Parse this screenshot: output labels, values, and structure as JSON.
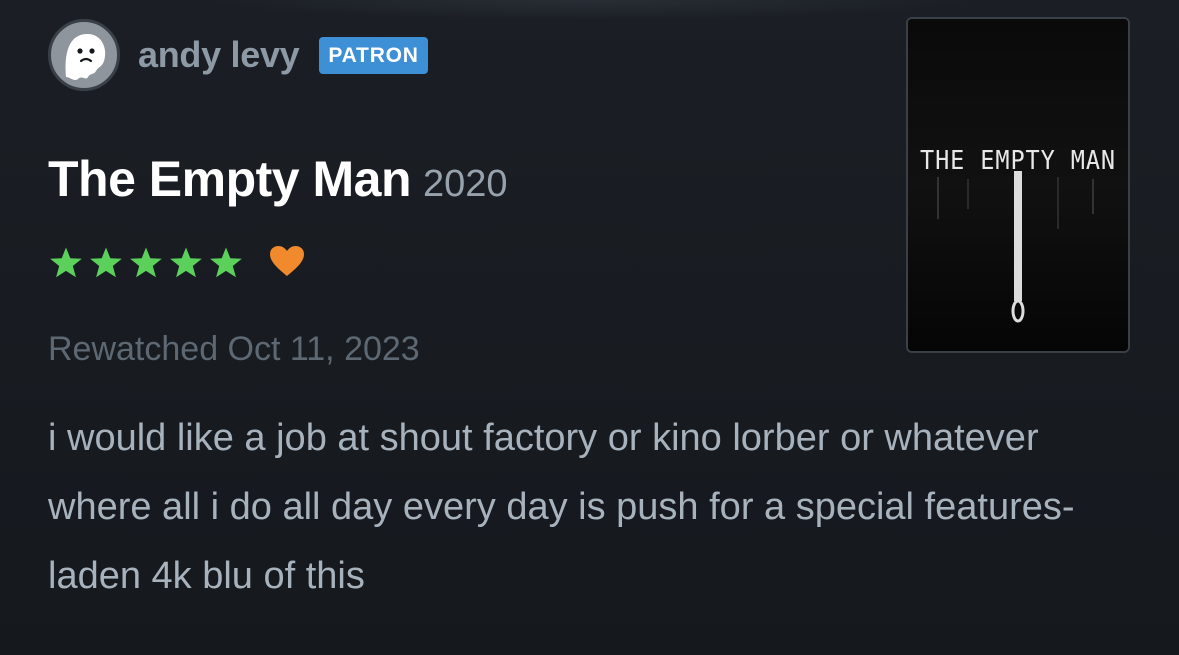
{
  "user": {
    "name": "andy levy",
    "badge": "PATRON"
  },
  "film": {
    "title": "The Empty Man",
    "year": "2020",
    "poster_text": "THE EMPTY MAN"
  },
  "rating": {
    "stars": 5,
    "max_stars": 5,
    "liked": true,
    "star_color": "#40bcf4",
    "star_fill": "#5bd15b",
    "heart_color": "#f1892d"
  },
  "watched": {
    "label": "Rewatched Oct 11, 2023"
  },
  "review": {
    "text": "i would like a job at shout factory or kino lorber or whatever where all i do all day every day is push for a special features-laden 4k blu of this"
  },
  "colors": {
    "background": "#14181c",
    "badge": "#3d8fd6"
  }
}
